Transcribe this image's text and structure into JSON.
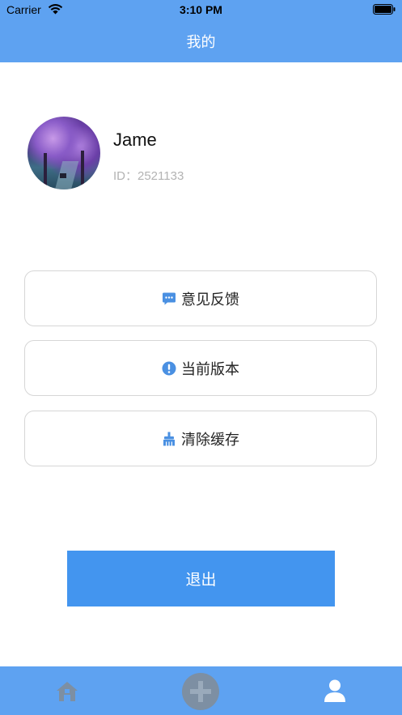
{
  "status_bar": {
    "carrier": "Carrier",
    "time": "3:10 PM",
    "icons": [
      "wifi-icon",
      "battery-icon"
    ]
  },
  "nav": {
    "title": "我的"
  },
  "profile": {
    "name": "Jame",
    "id_text": "ID：2521133"
  },
  "menu": {
    "items": [
      {
        "label": "意见反馈",
        "icon": "feedback-chat-icon"
      },
      {
        "label": "当前版本",
        "icon": "info-exclamation-icon"
      },
      {
        "label": "清除缓存",
        "icon": "broom-icon"
      }
    ]
  },
  "logout": {
    "label": "退出"
  },
  "tab_bar": {
    "tabs": [
      {
        "name": "home",
        "icon": "home-icon",
        "selected": false
      },
      {
        "name": "add",
        "icon": "add-icon",
        "selected": false
      },
      {
        "name": "me",
        "icon": "person-icon",
        "selected": true
      }
    ]
  },
  "colors": {
    "primary": "#5ea2f1",
    "button": "#4395ef",
    "icon_accent": "#4a90e2",
    "tab_inactive": "#7d8fa3",
    "tab_active": "#ffffff"
  }
}
